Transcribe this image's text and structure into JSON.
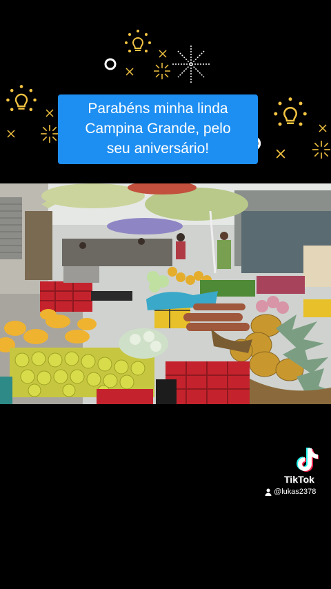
{
  "caption": {
    "line1": "Parabéns minha linda",
    "line2": "Campina Grande, pelo",
    "line3": "seu aniversário!"
  },
  "photo": {
    "subject": "street-market-fruit-stalls",
    "icon": "market-photo"
  },
  "watermark": {
    "brand": "TikTok",
    "username": "@lukas2378",
    "icon": "tiktok-logo-icon",
    "user_icon": "person-icon"
  },
  "colors": {
    "background": "#000000",
    "caption_bg": "#1e8ff2",
    "decoration": "#f5c542"
  }
}
